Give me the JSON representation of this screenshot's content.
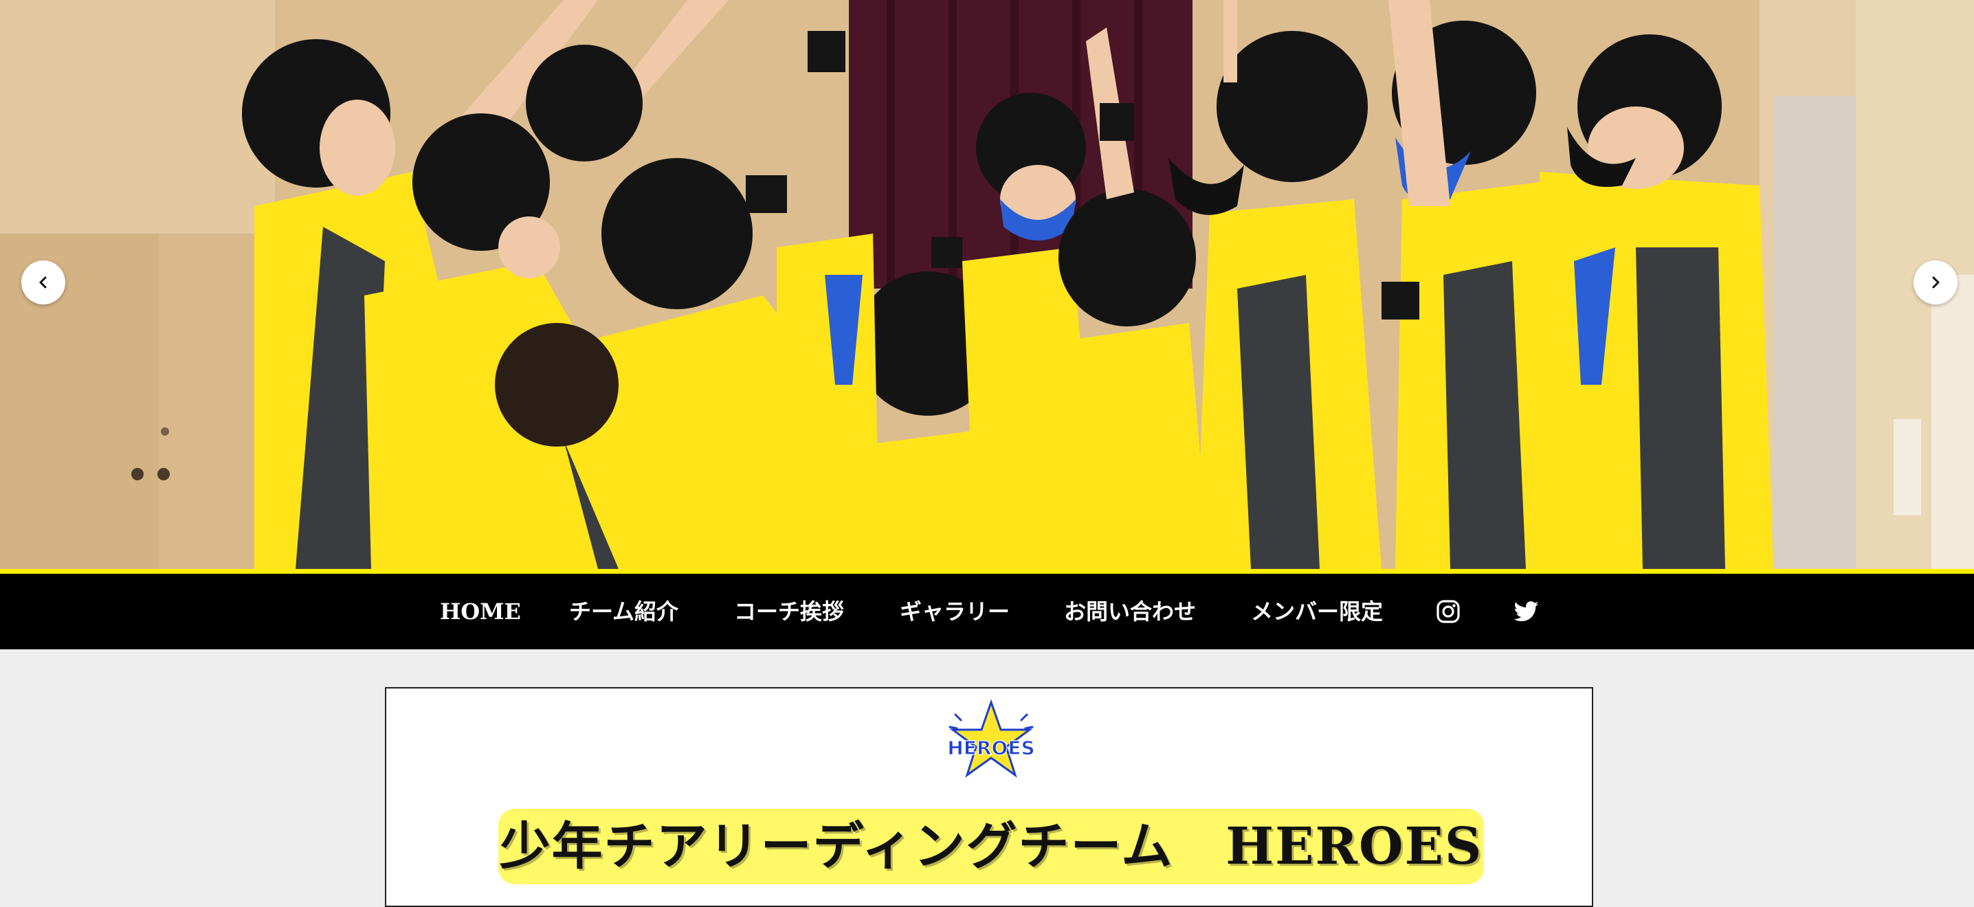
{
  "hero": {
    "photo_alt": "",
    "colors": {
      "jersey": "#ffe419",
      "dark_panel": "#3a3d40",
      "mask": "#2a5fd6",
      "curtain": "#4a1526"
    }
  },
  "slider": {
    "prev_icon": "chevron-left-icon",
    "next_icon": "chevron-right-icon"
  },
  "nav": {
    "items": [
      {
        "label": "HOME"
      },
      {
        "label": "チーム紹介"
      },
      {
        "label": "コーチ挨拶"
      },
      {
        "label": "ギャラリー"
      },
      {
        "label": "お問い合わせ"
      },
      {
        "label": "メンバー限定"
      }
    ],
    "social": [
      {
        "icon": "instagram-icon"
      },
      {
        "icon": "twitter-icon"
      }
    ]
  },
  "card": {
    "logo_text": "HEROES",
    "title": "少年チアリーディングチーム　HEROES"
  },
  "colors": {
    "accent_yellow": "#ffee00",
    "highlight": "#fff968",
    "nav_bg": "#000000",
    "page_bg": "#eeeeee",
    "logo_blue": "#1d3fd0",
    "logo_star": "#ffe62a"
  }
}
